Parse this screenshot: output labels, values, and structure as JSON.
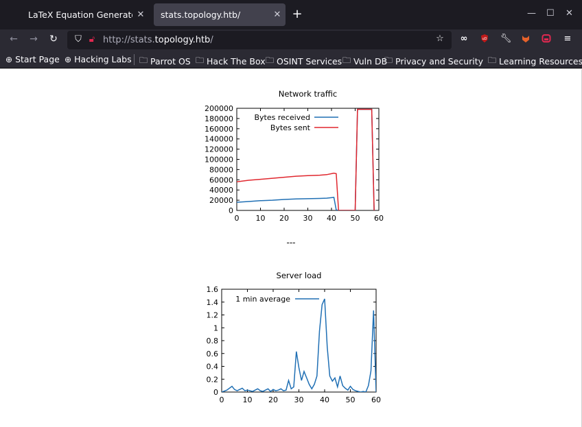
{
  "browser": {
    "tabs": [
      {
        "title": "LaTeX Equation Generator",
        "active": false
      },
      {
        "title": "stats.topology.htb/",
        "active": true
      }
    ],
    "url": {
      "prefix": "http://stats.",
      "host": "topology.htb",
      "suffix": "/"
    },
    "bookmarks": [
      {
        "label": "Start Page",
        "icon": "globe-icon"
      },
      {
        "label": "Hacking Labs",
        "icon": "globe-icon"
      },
      {
        "label": "Parrot OS",
        "icon": "folder-icon"
      },
      {
        "label": "Hack The Box",
        "icon": "folder-icon"
      },
      {
        "label": "OSINT Services",
        "icon": "folder-icon"
      },
      {
        "label": "Vuln DB",
        "icon": "folder-icon"
      },
      {
        "label": "Privacy and Security",
        "icon": "folder-icon"
      },
      {
        "label": "Learning Resources",
        "icon": "folder-icon"
      }
    ]
  },
  "page": {
    "separator": "---"
  },
  "chart_data": [
    {
      "type": "line",
      "title": "Network traffic",
      "xlim": [
        0,
        60
      ],
      "ylim": [
        0,
        200000
      ],
      "xticks": [
        0,
        10,
        20,
        30,
        40,
        50,
        60
      ],
      "yticks": [
        0,
        20000,
        40000,
        60000,
        80000,
        100000,
        120000,
        140000,
        160000,
        180000,
        200000
      ],
      "legend_position": "top-right",
      "series": [
        {
          "name": "Bytes received",
          "color": "#1f6fb4",
          "x": [
            0,
            5,
            10,
            15,
            20,
            25,
            30,
            35,
            38,
            40,
            41,
            42,
            43,
            44,
            49,
            50,
            51,
            52,
            53,
            54,
            55,
            56,
            57,
            58
          ],
          "y": [
            16000,
            17500,
            19000,
            20000,
            21500,
            22500,
            23000,
            23500,
            24000,
            25000,
            25500,
            1000,
            0,
            0,
            0,
            0,
            198000,
            198000,
            198000,
            198000,
            198000,
            198000,
            198000,
            0
          ]
        },
        {
          "name": "Bytes sent",
          "color": "#e0262d",
          "x": [
            0,
            5,
            10,
            15,
            20,
            25,
            30,
            35,
            38,
            40,
            41,
            42,
            43,
            44,
            49,
            50,
            51,
            52,
            53,
            54,
            55,
            56,
            57,
            58
          ],
          "y": [
            56000,
            59000,
            61000,
            63000,
            65000,
            67000,
            68000,
            69000,
            70000,
            72000,
            73000,
            72000,
            0,
            0,
            0,
            0,
            198000,
            198000,
            198000,
            198000,
            198000,
            198000,
            198000,
            0
          ]
        }
      ]
    },
    {
      "type": "line",
      "title": "Server load",
      "xlim": [
        0,
        60
      ],
      "ylim": [
        0,
        1.6
      ],
      "xticks": [
        0,
        10,
        20,
        30,
        40,
        50,
        60
      ],
      "yticks": [
        0,
        0.2,
        0.4,
        0.6,
        0.8,
        1,
        1.2,
        1.4,
        1.6
      ],
      "legend_position": "top-left",
      "series": [
        {
          "name": "1 min average",
          "color": "#1f6fb4",
          "x": [
            0,
            2,
            4,
            5,
            6,
            8,
            9,
            10,
            12,
            14,
            15,
            16,
            18,
            19,
            20,
            21,
            22,
            23,
            24,
            25,
            26,
            27,
            28,
            29,
            30,
            31,
            32,
            33,
            34,
            35,
            36,
            37,
            38,
            39,
            40,
            41,
            42,
            43,
            44,
            45,
            46,
            47,
            48,
            49,
            50,
            51,
            52,
            53,
            54,
            55,
            56,
            57,
            58,
            59,
            60
          ],
          "y": [
            0,
            0.03,
            0.09,
            0.04,
            0.02,
            0.06,
            0.02,
            0.03,
            0.01,
            0.05,
            0.02,
            0.01,
            0.05,
            0.01,
            0.04,
            0.02,
            0.03,
            0.05,
            0.02,
            0.03,
            0.18,
            0.05,
            0.08,
            0.63,
            0.38,
            0.18,
            0.32,
            0.22,
            0.12,
            0.05,
            0.12,
            0.25,
            0.95,
            1.36,
            1.45,
            0.7,
            0.25,
            0.17,
            0.22,
            0.08,
            0.25,
            0.1,
            0.06,
            0.03,
            0.09,
            0.04,
            0.02,
            0.01,
            0.0,
            0.01,
            0.0,
            0.1,
            0.33,
            1.27,
            0.0
          ]
        }
      ]
    }
  ]
}
